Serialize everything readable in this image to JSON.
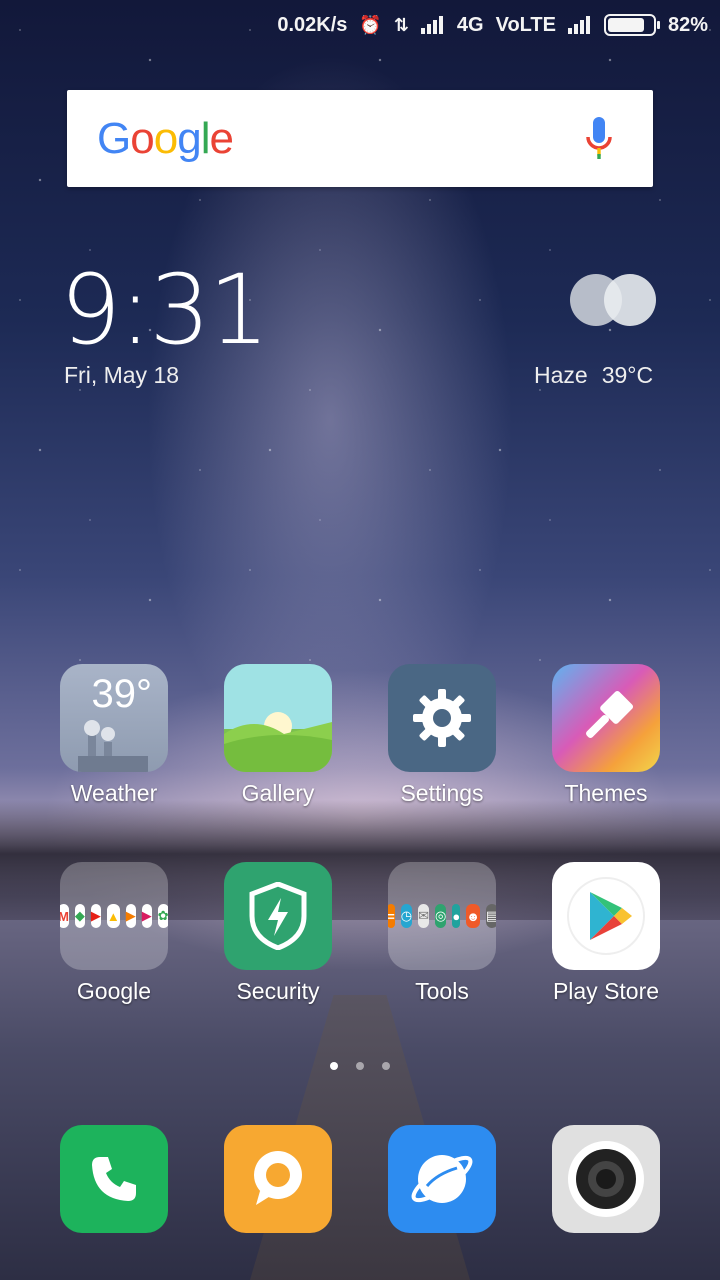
{
  "status_bar": {
    "speed": "0.02K/s",
    "network": "4G",
    "volte": "VoLTE",
    "battery_percent": "82%",
    "battery_level": 0.82
  },
  "search": {
    "logo_text": [
      "G",
      "o",
      "o",
      "g",
      "l",
      "e"
    ]
  },
  "clock": {
    "time": "9:31",
    "date": "Fri, May 18"
  },
  "weather": {
    "condition": "Haze",
    "temp": "39°C"
  },
  "apps": {
    "weather": {
      "label": "Weather",
      "temp": "39°"
    },
    "gallery": {
      "label": "Gallery"
    },
    "settings": {
      "label": "Settings"
    },
    "themes": {
      "label": "Themes"
    },
    "google": {
      "label": "Google"
    },
    "security": {
      "label": "Security"
    },
    "tools": {
      "label": "Tools"
    },
    "play_store": {
      "label": "Play Store"
    }
  },
  "pager": {
    "pages": 3,
    "current": 1
  },
  "dock": [
    "phone",
    "messaging",
    "browser",
    "camera"
  ]
}
